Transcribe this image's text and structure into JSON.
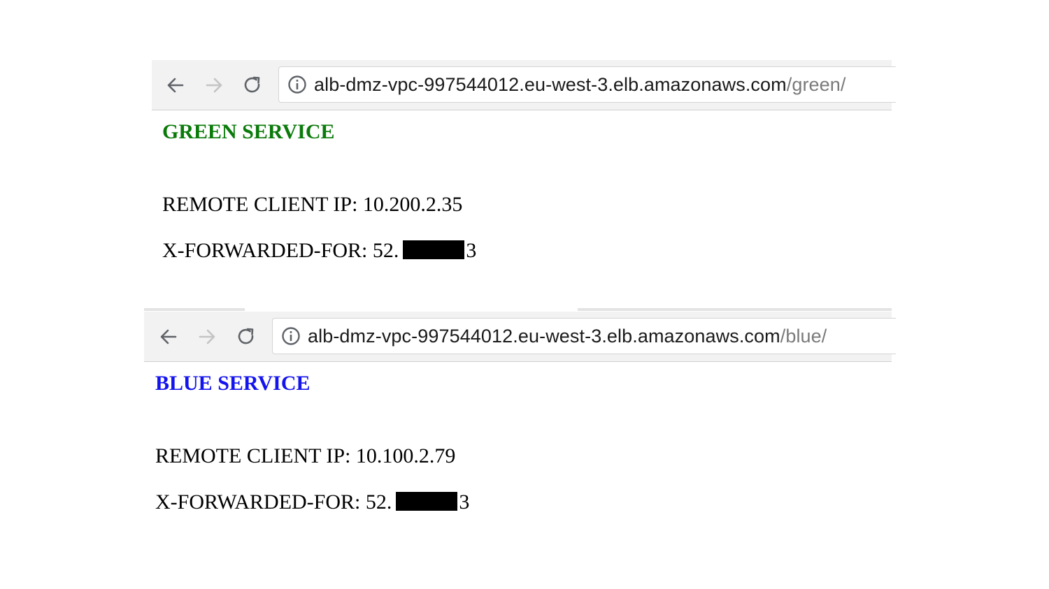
{
  "windows": [
    {
      "url_host": "alb-dmz-vpc-997544012.eu-west-3.elb.amazonaws.com",
      "url_path": "/green/",
      "title": "GREEN SERVICE",
      "title_color": "#0a7a0a",
      "remote_ip_line": "REMOTE CLIENT IP: 10.200.2.35",
      "xff_prefix": "X-FORWARDED-FOR: 52.",
      "xff_tail": "3"
    },
    {
      "url_host": "alb-dmz-vpc-997544012.eu-west-3.elb.amazonaws.com",
      "url_path": "/blue/",
      "title": "BLUE SERVICE",
      "title_color": "#1414ee",
      "remote_ip_line": "REMOTE CLIENT IP: 10.100.2.79",
      "xff_prefix": "X-FORWARDED-FOR: 52.",
      "xff_tail": "3"
    }
  ],
  "icons": {
    "back": "back-arrow-icon",
    "forward": "forward-arrow-icon",
    "reload": "reload-icon",
    "info": "info-icon"
  }
}
